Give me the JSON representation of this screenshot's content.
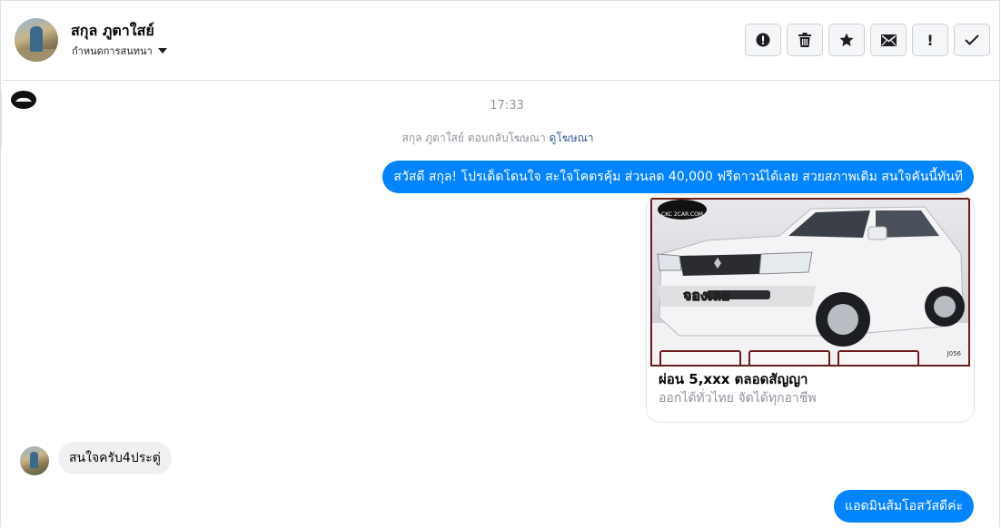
{
  "header": {
    "contact_name": "สกุล ภูตาใสย์",
    "conversation_setting": "กำหนดการสนทนา",
    "actions": [
      {
        "name": "report-button",
        "icon": "alert-circle-icon"
      },
      {
        "name": "delete-button",
        "icon": "trash-icon"
      },
      {
        "name": "star-button",
        "icon": "star-icon"
      },
      {
        "name": "mark-unread-button",
        "icon": "envelope-icon"
      },
      {
        "name": "important-button",
        "icon": "exclamation-icon"
      },
      {
        "name": "mark-done-button",
        "icon": "check-icon"
      }
    ]
  },
  "messages": {
    "timestamp": "17:33",
    "reply_note": "สกุล ภูตาใสย์ ตอบกลับโฆษณา",
    "reply_note_link": "ดูโฆษณา",
    "outgoing_1": "สวัสดี สกุล! โปรเด็ดโดนใจ สะใจโคตรคุ้ม ส่วนลด 40,000 ฟรีดาวน์ได้เลย สวยสภาพเดิม สนใจคันนี้ทันที",
    "ad_card": {
      "title": "ผ่อน 5,xxx ตลอดสัญญา",
      "subtitle": "ออกได้ทั่วไทย จัดได้ทุกอาชีพ",
      "image_logo_text": "CKC 2CAR.COM",
      "image_promo_text": "จองเลย",
      "image_code": "J056"
    },
    "incoming_1": "สนใจครับ4ประตู่",
    "outgoing_2": "แอดมินส้มโอสวัสดีค่ะ"
  },
  "colors": {
    "outgoing_bubble": "#0084ff",
    "incoming_bubble": "#f1f0f0",
    "link": "#385898",
    "meta_text": "#90949c"
  }
}
